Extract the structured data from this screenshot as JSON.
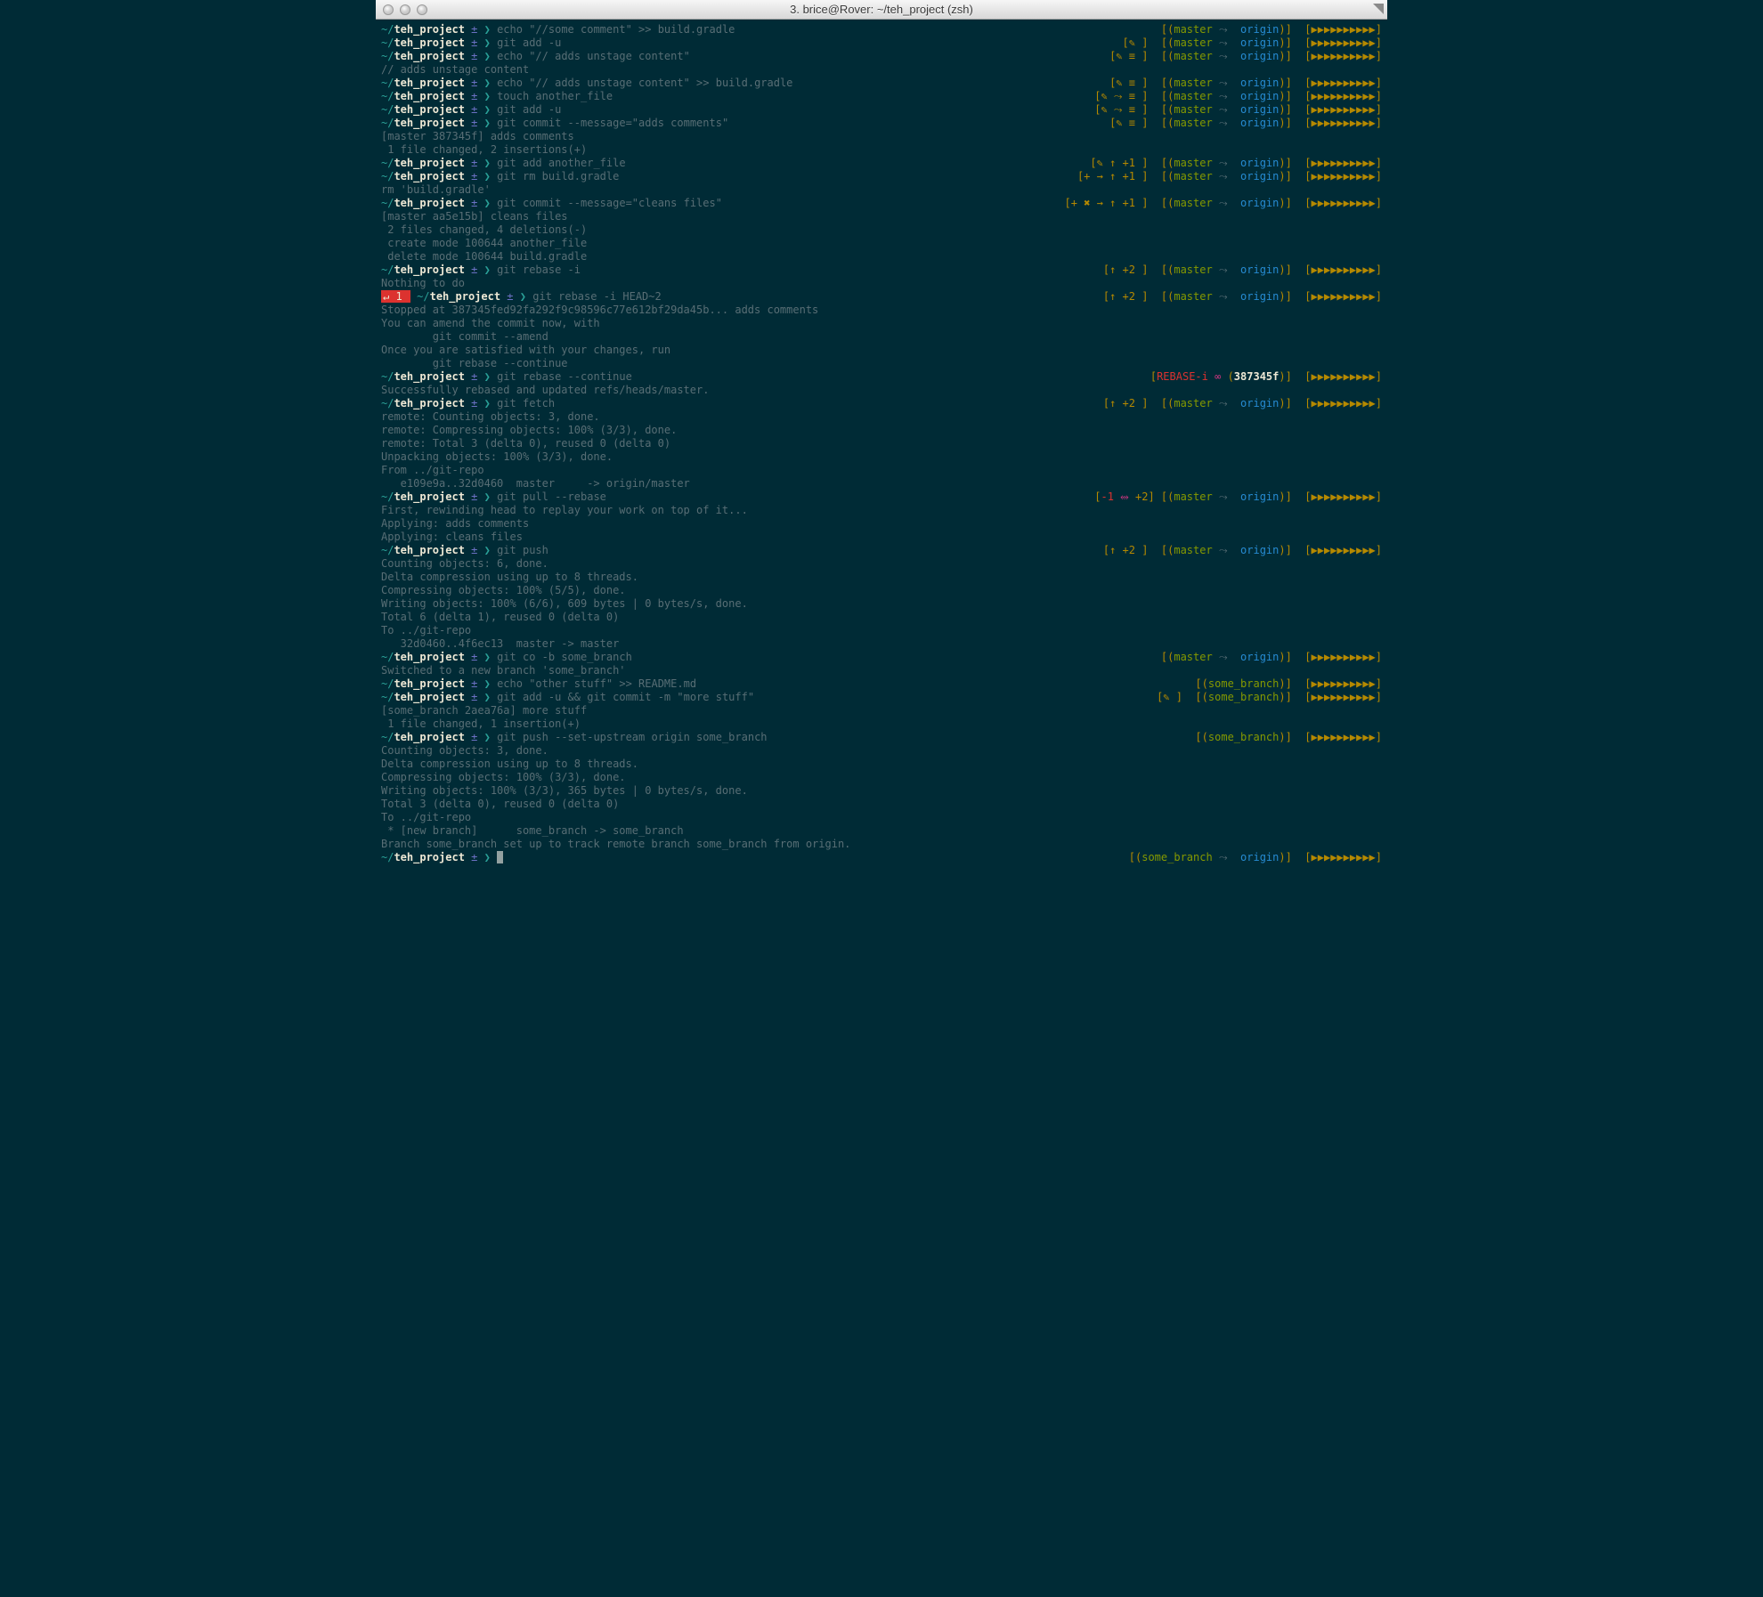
{
  "window": {
    "title": "3. brice@Rover: ~/teh_project (zsh)"
  },
  "prompt": {
    "path_prefix": "~/",
    "dir": "teh_project",
    "sep": " ± ",
    "caret": "❯ "
  },
  "lines": [
    {
      "cmd": "echo \"//some comment\" >> build.gradle",
      "rstatus": "",
      "branch": "master",
      "remote": "origin"
    },
    {
      "cmd": "git add -u",
      "rstatus": "[✎ ]",
      "branch": "master",
      "remote": "origin"
    },
    {
      "cmd": "echo \"// adds unstage content\"",
      "rstatus": "[✎ ≡ ]",
      "branch": "master",
      "remote": "origin"
    },
    {
      "out": "// adds unstage content"
    },
    {
      "cmd": "echo \"// adds unstage content\" >> build.gradle",
      "rstatus": "[✎ ≡ ]",
      "branch": "master",
      "remote": "origin"
    },
    {
      "cmd": "touch another_file",
      "rstatus": "[✎ ⤳ ≡ ]",
      "branch": "master",
      "remote": "origin"
    },
    {
      "cmd": "git add -u",
      "rstatus": "[✎ ⤳ ≡ ]",
      "branch": "master",
      "remote": "origin"
    },
    {
      "cmd": "git commit --message=\"adds comments\"",
      "rstatus": "[✎ ≡ ]",
      "branch": "master",
      "remote": "origin"
    },
    {
      "out": "[master 387345f] adds comments"
    },
    {
      "out": " 1 file changed, 2 insertions(+)"
    },
    {
      "cmd": "git add another_file",
      "rstatus": "[✎ ↑ +1 ]",
      "branch": "master",
      "remote": "origin"
    },
    {
      "cmd": "git rm build.gradle",
      "rstatus": "[+ → ↑ +1 ]",
      "branch": "master",
      "remote": "origin"
    },
    {
      "out": "rm 'build.gradle'"
    },
    {
      "cmd": "git commit --message=\"cleans files\"",
      "rstatus": "[+ ✖ → ↑ +1 ]",
      "branch": "master",
      "remote": "origin"
    },
    {
      "out": "[master aa5e15b] cleans files"
    },
    {
      "out": " 2 files changed, 4 deletions(-)"
    },
    {
      "out": " create mode 100644 another_file"
    },
    {
      "out": " delete mode 100644 build.gradle"
    },
    {
      "cmd": "git rebase -i",
      "rstatus": "[↑ +2 ]",
      "branch": "master",
      "remote": "origin"
    },
    {
      "out": "Nothing to do"
    },
    {
      "err_prefix": "↵ 1 ",
      "cmd": "git rebase -i HEAD~2",
      "rstatus": "[↑ +2 ]",
      "branch": "master",
      "remote": "origin"
    },
    {
      "out": "Stopped at 387345fed92fa292f9c98596c77e612bf29da45b... adds comments"
    },
    {
      "out": "You can amend the commit now, with"
    },
    {
      "out": ""
    },
    {
      "out": "        git commit --amend"
    },
    {
      "out": ""
    },
    {
      "out": "Once you are satisfied with your changes, run"
    },
    {
      "out": ""
    },
    {
      "out": "        git rebase --continue"
    },
    {
      "out": ""
    },
    {
      "cmd": "git rebase --continue",
      "rebase": "REBASE-i",
      "hash": "387345f"
    },
    {
      "out": "Successfully rebased and updated refs/heads/master."
    },
    {
      "cmd": "git fetch",
      "rstatus": "[↑ +2 ]",
      "branch": "master",
      "remote": "origin"
    },
    {
      "out": "remote: Counting objects: 3, done."
    },
    {
      "out": "remote: Compressing objects: 100% (3/3), done."
    },
    {
      "out": "remote: Total 3 (delta 0), reused 0 (delta 0)"
    },
    {
      "out": "Unpacking objects: 100% (3/3), done."
    },
    {
      "out": "From ../git-repo"
    },
    {
      "out": "   e109e9a..32d0460  master     -> origin/master"
    },
    {
      "cmd": "git pull --rebase",
      "rstatus": "[-1 ⥈ +2 ]",
      "diverge": true,
      "branch": "master",
      "remote": "origin"
    },
    {
      "out": "First, rewinding head to replay your work on top of it..."
    },
    {
      "out": "Applying: adds comments"
    },
    {
      "out": "Applying: cleans files"
    },
    {
      "cmd": "git push",
      "rstatus": "[↑ +2 ]",
      "branch": "master",
      "remote": "origin"
    },
    {
      "out": "Counting objects: 6, done."
    },
    {
      "out": "Delta compression using up to 8 threads."
    },
    {
      "out": "Compressing objects: 100% (5/5), done."
    },
    {
      "out": "Writing objects: 100% (6/6), 609 bytes | 0 bytes/s, done."
    },
    {
      "out": "Total 6 (delta 1), reused 0 (delta 0)"
    },
    {
      "out": "To ../git-repo"
    },
    {
      "out": "   32d0460..4f6ec13  master -> master"
    },
    {
      "cmd": "git co -b some_branch",
      "rstatus": "",
      "branch": "master",
      "remote": "origin"
    },
    {
      "out": "Switched to a new branch 'some_branch'"
    },
    {
      "cmd": "echo \"other stuff\" >> README.md",
      "rstatus": "",
      "branch": "some_branch"
    },
    {
      "cmd": "git add -u && git commit -m \"more stuff\"",
      "rstatus": "[✎ ]",
      "branch": "some_branch"
    },
    {
      "out": "[some_branch 2aea76a] more stuff"
    },
    {
      "out": " 1 file changed, 1 insertion(+)"
    },
    {
      "cmd": "git push --set-upstream origin some_branch",
      "rstatus": "",
      "branch": "some_branch"
    },
    {
      "out": "Counting objects: 3, done."
    },
    {
      "out": "Delta compression using up to 8 threads."
    },
    {
      "out": "Compressing objects: 100% (3/3), done."
    },
    {
      "out": "Writing objects: 100% (3/3), 365 bytes | 0 bytes/s, done."
    },
    {
      "out": "Total 3 (delta 0), reused 0 (delta 0)"
    },
    {
      "out": "To ../git-repo"
    },
    {
      "out": " * [new branch]      some_branch -> some_branch"
    },
    {
      "out": "Branch some_branch set up to track remote branch some_branch from origin."
    },
    {
      "cmd": "",
      "cursor": true,
      "rstatus": "",
      "branch": "some_branch",
      "remote": "origin"
    }
  ],
  "glyphs": {
    "arrows": "▶▶▶▶▶▶▶▶▶▶"
  }
}
